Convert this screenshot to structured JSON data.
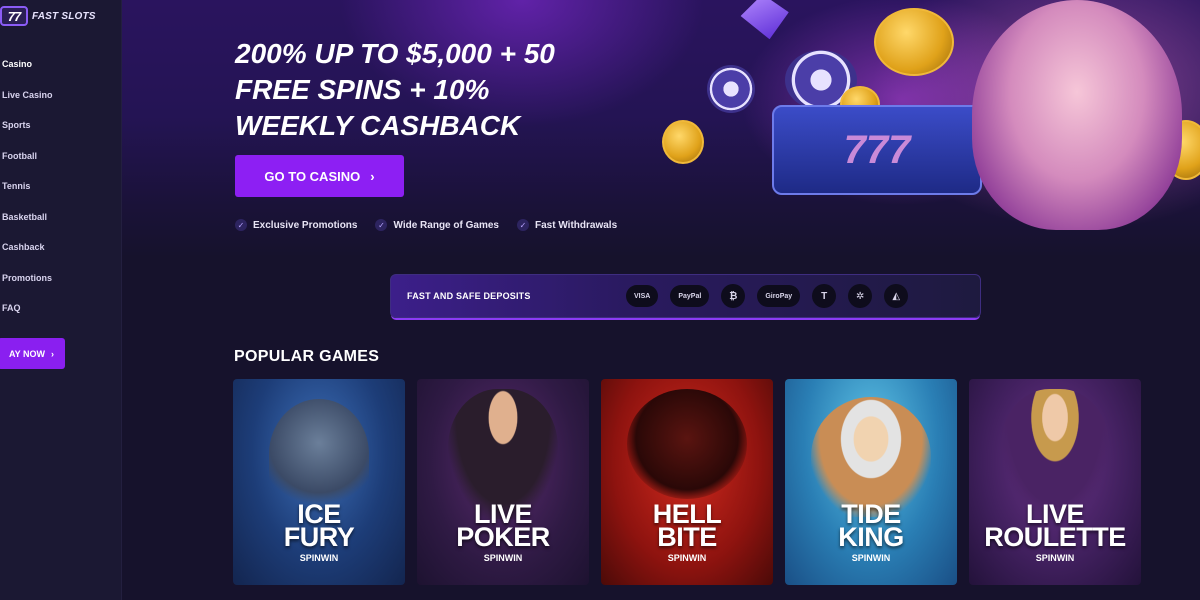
{
  "brand": {
    "logo_badge": "77",
    "name": "FAST SLOTS"
  },
  "sidebar": {
    "items": [
      {
        "label": "Casino",
        "active": true
      },
      {
        "label": "Live Casino"
      },
      {
        "label": "Sports"
      },
      {
        "label": "Football"
      },
      {
        "label": "Tennis"
      },
      {
        "label": "Basketball"
      },
      {
        "label": "Cashback"
      },
      {
        "label": "Promotions"
      },
      {
        "label": "FAQ"
      }
    ],
    "play_button": "AY NOW"
  },
  "hero": {
    "title": "200% UP TO $5,000 + 50\nFREE SPINS + 10%\nWEEKLY CASHBACK",
    "cta_label": "GO TO CASINO",
    "features": [
      "Exclusive Promotions",
      "Wide Range of Games",
      "Fast Withdrawals"
    ],
    "slot_text": "777"
  },
  "deposits": {
    "label": "FAST AND SAFE DEPOSITS",
    "methods": [
      {
        "name": "visa",
        "label": "VISA",
        "icon": "visa-icon"
      },
      {
        "name": "paypal",
        "label": "PayPal",
        "icon": "paypal-icon"
      },
      {
        "name": "bitcoin",
        "label": "₿",
        "icon": "bitcoin-icon"
      },
      {
        "name": "giropay",
        "label": "GiroPay",
        "icon": "giropay-icon"
      },
      {
        "name": "tether",
        "label": "T",
        "icon": "tether-icon"
      },
      {
        "name": "cardano",
        "label": "✲",
        "icon": "cardano-icon"
      },
      {
        "name": "tron",
        "label": "◭",
        "icon": "tron-icon"
      }
    ]
  },
  "popular_games": {
    "title": "POPULAR GAMES",
    "games": [
      {
        "name": "ICE\nFURY",
        "provider": "SPINWIN"
      },
      {
        "name": "LIVE\nPOKER",
        "provider": "SPINWIN"
      },
      {
        "name": "HELL\nBITE",
        "provider": "SPINWIN"
      },
      {
        "name": "TIDE\nKING",
        "provider": "SPINWIN"
      },
      {
        "name": "LIVE\nROULETTE",
        "provider": "SPINWIN"
      }
    ]
  },
  "colors": {
    "accent": "#8d1ff3",
    "sidebar_bg": "#1b1833",
    "page_bg": "#16122c"
  }
}
